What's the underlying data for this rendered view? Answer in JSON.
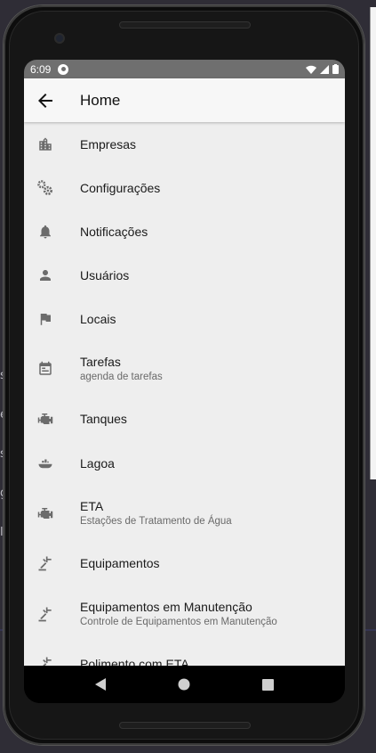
{
  "status_bar": {
    "time": "6:09"
  },
  "app_bar": {
    "title": "Home"
  },
  "menu": [
    {
      "icon": "building-icon",
      "title": "Empresas",
      "subtitle": ""
    },
    {
      "icon": "settings-icon",
      "title": "Configurações",
      "subtitle": ""
    },
    {
      "icon": "bell-icon",
      "title": "Notificações",
      "subtitle": ""
    },
    {
      "icon": "person-icon",
      "title": "Usuários",
      "subtitle": ""
    },
    {
      "icon": "flag-icon",
      "title": "Locais",
      "subtitle": ""
    },
    {
      "icon": "calendar-icon",
      "title": "Tarefas",
      "subtitle": "agenda de tarefas"
    },
    {
      "icon": "engine-icon",
      "title": "Tanques",
      "subtitle": ""
    },
    {
      "icon": "ship-icon",
      "title": "Lagoa",
      "subtitle": ""
    },
    {
      "icon": "engine-icon",
      "title": "ETA",
      "subtitle": "Estações de Tratamento de Água"
    },
    {
      "icon": "tool-icon",
      "title": "Equipamentos",
      "subtitle": ""
    },
    {
      "icon": "tool-icon",
      "title": "Equipamentos em Manutenção",
      "subtitle": "Controle de Equipamentos em Manutenção"
    },
    {
      "icon": "tool-icon",
      "title": "Polimento com ETA",
      "subtitle": ""
    }
  ],
  "desk_side_letters": [
    "s",
    "e",
    "s",
    "g",
    "l"
  ],
  "colors": {
    "app_bar_bg": "#f7f7f7",
    "list_bg": "#eeeeee",
    "icon_color": "#6b6b6b",
    "status_bar_bg": "#6f6f6f"
  }
}
